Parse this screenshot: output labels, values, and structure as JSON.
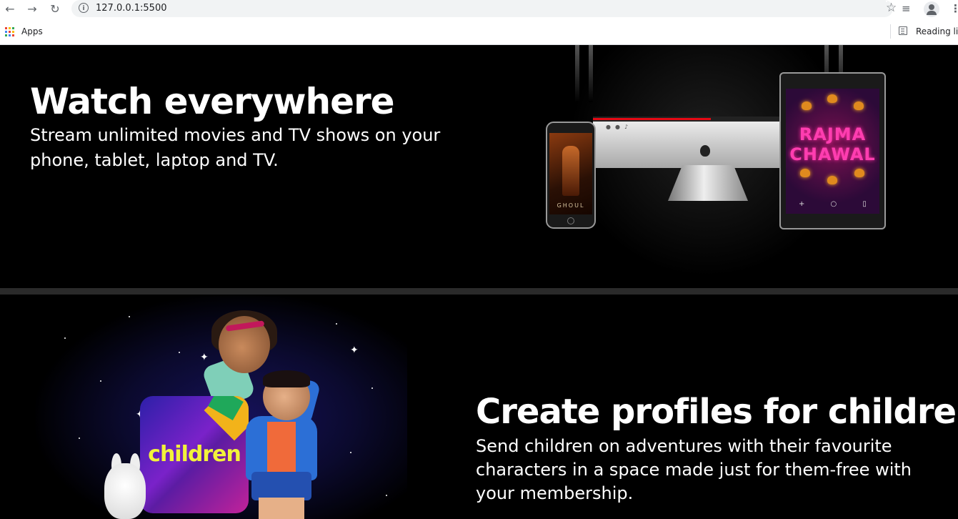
{
  "browser": {
    "url": "127.0.0.1:5500",
    "bookmarks": {
      "apps_label": "Apps",
      "reading_list_label": "Reading list"
    },
    "icons": [
      "back-arrow-icon",
      "forward-arrow-icon",
      "reload-icon",
      "info-icon",
      "bookmark-star-icon",
      "media-control-icon",
      "profile-icon",
      "menu-icon",
      "apps-grid-icon",
      "reading-list-icon"
    ]
  },
  "sections": [
    {
      "title": "Watch everywhere",
      "description": "Stream unlimited movies and TV shows on your phone, tablet, laptop and TV.",
      "devices": {
        "phone_poster_title": "GHOUL",
        "tablet_poster_title_line1": "RAJMA",
        "tablet_poster_title_line2": "CHAWAL"
      }
    },
    {
      "title": "Create profiles for children.",
      "description": "Send children on adventures with their favourite characters in a space made just for them-free with your membership.",
      "image": {
        "tile_label": "children"
      }
    }
  ],
  "colors": {
    "background": "#000000",
    "text": "#ffffff",
    "separator": "#2a2a2a",
    "accent": "#e50914",
    "children_label": "#f2f23a"
  }
}
